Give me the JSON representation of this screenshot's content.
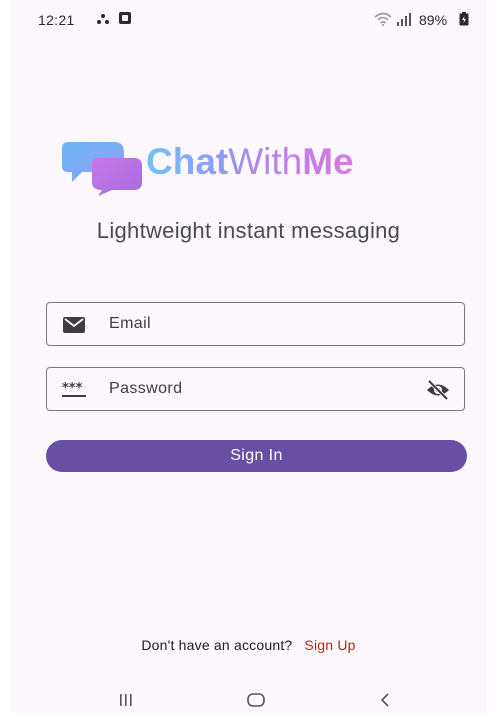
{
  "status_bar": {
    "time": "12:21",
    "battery": "89%",
    "icons": [
      "notification-icon",
      "gallery-icon",
      "wifi-icon",
      "signal-icon",
      "battery-icon"
    ]
  },
  "logo": {
    "part1": "Chat",
    "part2": "With",
    "part3": "Me",
    "colors": {
      "blue": "#74c2f7",
      "purple": "#c47ce6"
    }
  },
  "tagline": "Lightweight instant messaging",
  "email_field": {
    "placeholder": "Email",
    "value": "",
    "icon": "mail-icon"
  },
  "password_field": {
    "placeholder": "Password",
    "value": "",
    "icon": "password-icon",
    "toggle_icon": "visibility-off-icon"
  },
  "sign_in": {
    "label": "Sign In",
    "color": "#6750a4"
  },
  "sign_up": {
    "prompt": "Don't have an account?",
    "link": "Sign Up",
    "link_color": "#b3261e"
  },
  "nav_bar": {
    "icons": [
      "recents-icon",
      "home-icon",
      "back-icon"
    ]
  }
}
